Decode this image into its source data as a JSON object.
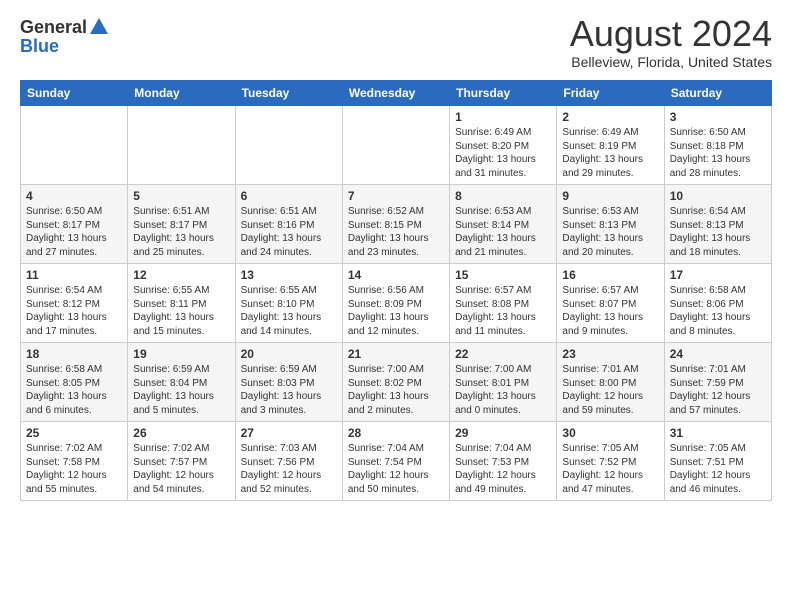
{
  "logo": {
    "general": "General",
    "blue": "Blue"
  },
  "header": {
    "month_year": "August 2024",
    "location": "Belleview, Florida, United States"
  },
  "weekdays": [
    "Sunday",
    "Monday",
    "Tuesday",
    "Wednesday",
    "Thursday",
    "Friday",
    "Saturday"
  ],
  "weeks": [
    [
      {
        "day": "",
        "info": ""
      },
      {
        "day": "",
        "info": ""
      },
      {
        "day": "",
        "info": ""
      },
      {
        "day": "",
        "info": ""
      },
      {
        "day": "1",
        "info": "Sunrise: 6:49 AM\nSunset: 8:20 PM\nDaylight: 13 hours\nand 31 minutes."
      },
      {
        "day": "2",
        "info": "Sunrise: 6:49 AM\nSunset: 8:19 PM\nDaylight: 13 hours\nand 29 minutes."
      },
      {
        "day": "3",
        "info": "Sunrise: 6:50 AM\nSunset: 8:18 PM\nDaylight: 13 hours\nand 28 minutes."
      }
    ],
    [
      {
        "day": "4",
        "info": "Sunrise: 6:50 AM\nSunset: 8:17 PM\nDaylight: 13 hours\nand 27 minutes."
      },
      {
        "day": "5",
        "info": "Sunrise: 6:51 AM\nSunset: 8:17 PM\nDaylight: 13 hours\nand 25 minutes."
      },
      {
        "day": "6",
        "info": "Sunrise: 6:51 AM\nSunset: 8:16 PM\nDaylight: 13 hours\nand 24 minutes."
      },
      {
        "day": "7",
        "info": "Sunrise: 6:52 AM\nSunset: 8:15 PM\nDaylight: 13 hours\nand 23 minutes."
      },
      {
        "day": "8",
        "info": "Sunrise: 6:53 AM\nSunset: 8:14 PM\nDaylight: 13 hours\nand 21 minutes."
      },
      {
        "day": "9",
        "info": "Sunrise: 6:53 AM\nSunset: 8:13 PM\nDaylight: 13 hours\nand 20 minutes."
      },
      {
        "day": "10",
        "info": "Sunrise: 6:54 AM\nSunset: 8:13 PM\nDaylight: 13 hours\nand 18 minutes."
      }
    ],
    [
      {
        "day": "11",
        "info": "Sunrise: 6:54 AM\nSunset: 8:12 PM\nDaylight: 13 hours\nand 17 minutes."
      },
      {
        "day": "12",
        "info": "Sunrise: 6:55 AM\nSunset: 8:11 PM\nDaylight: 13 hours\nand 15 minutes."
      },
      {
        "day": "13",
        "info": "Sunrise: 6:55 AM\nSunset: 8:10 PM\nDaylight: 13 hours\nand 14 minutes."
      },
      {
        "day": "14",
        "info": "Sunrise: 6:56 AM\nSunset: 8:09 PM\nDaylight: 13 hours\nand 12 minutes."
      },
      {
        "day": "15",
        "info": "Sunrise: 6:57 AM\nSunset: 8:08 PM\nDaylight: 13 hours\nand 11 minutes."
      },
      {
        "day": "16",
        "info": "Sunrise: 6:57 AM\nSunset: 8:07 PM\nDaylight: 13 hours\nand 9 minutes."
      },
      {
        "day": "17",
        "info": "Sunrise: 6:58 AM\nSunset: 8:06 PM\nDaylight: 13 hours\nand 8 minutes."
      }
    ],
    [
      {
        "day": "18",
        "info": "Sunrise: 6:58 AM\nSunset: 8:05 PM\nDaylight: 13 hours\nand 6 minutes."
      },
      {
        "day": "19",
        "info": "Sunrise: 6:59 AM\nSunset: 8:04 PM\nDaylight: 13 hours\nand 5 minutes."
      },
      {
        "day": "20",
        "info": "Sunrise: 6:59 AM\nSunset: 8:03 PM\nDaylight: 13 hours\nand 3 minutes."
      },
      {
        "day": "21",
        "info": "Sunrise: 7:00 AM\nSunset: 8:02 PM\nDaylight: 13 hours\nand 2 minutes."
      },
      {
        "day": "22",
        "info": "Sunrise: 7:00 AM\nSunset: 8:01 PM\nDaylight: 13 hours\nand 0 minutes."
      },
      {
        "day": "23",
        "info": "Sunrise: 7:01 AM\nSunset: 8:00 PM\nDaylight: 12 hours\nand 59 minutes."
      },
      {
        "day": "24",
        "info": "Sunrise: 7:01 AM\nSunset: 7:59 PM\nDaylight: 12 hours\nand 57 minutes."
      }
    ],
    [
      {
        "day": "25",
        "info": "Sunrise: 7:02 AM\nSunset: 7:58 PM\nDaylight: 12 hours\nand 55 minutes."
      },
      {
        "day": "26",
        "info": "Sunrise: 7:02 AM\nSunset: 7:57 PM\nDaylight: 12 hours\nand 54 minutes."
      },
      {
        "day": "27",
        "info": "Sunrise: 7:03 AM\nSunset: 7:56 PM\nDaylight: 12 hours\nand 52 minutes."
      },
      {
        "day": "28",
        "info": "Sunrise: 7:04 AM\nSunset: 7:54 PM\nDaylight: 12 hours\nand 50 minutes."
      },
      {
        "day": "29",
        "info": "Sunrise: 7:04 AM\nSunset: 7:53 PM\nDaylight: 12 hours\nand 49 minutes."
      },
      {
        "day": "30",
        "info": "Sunrise: 7:05 AM\nSunset: 7:52 PM\nDaylight: 12 hours\nand 47 minutes."
      },
      {
        "day": "31",
        "info": "Sunrise: 7:05 AM\nSunset: 7:51 PM\nDaylight: 12 hours\nand 46 minutes."
      }
    ]
  ]
}
